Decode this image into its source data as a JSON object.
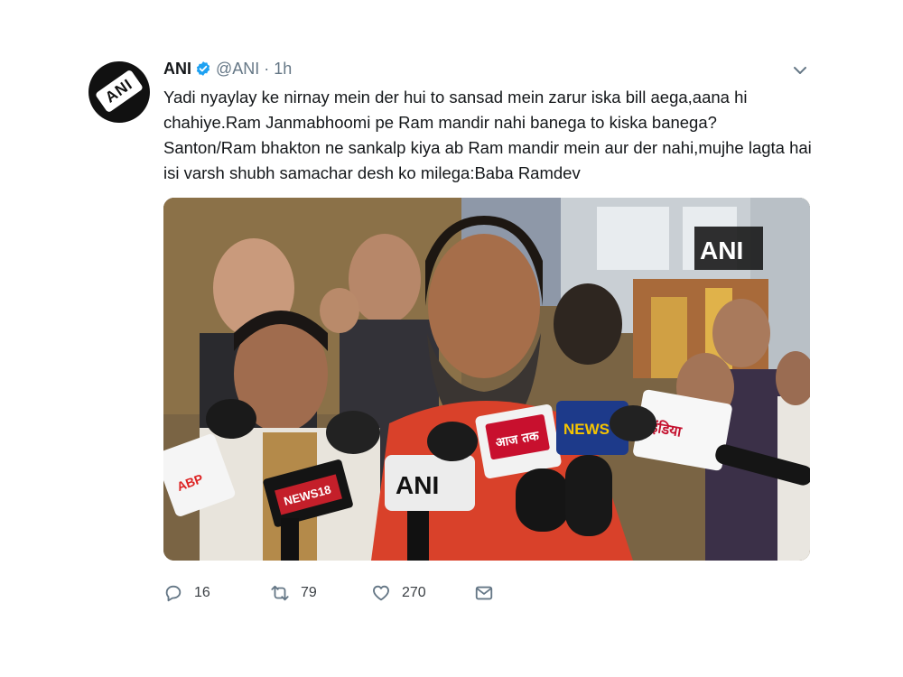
{
  "tweet": {
    "author_name": "ANI",
    "handle": "@ANI",
    "separator": "·",
    "time": "1h",
    "text": "Yadi nyaylay ke nirnay mein der hui to sansad mein zarur iska bill aega,aana hi chahiye.Ram Janmabhoomi pe Ram mandir nahi banega to kiska banega? Santon/Ram bhakton ne sankalp kiya ab Ram mandir mein aur der nahi,mujhe lagta hai isi varsh shubh samachar desh ko milega:Baba Ramdev",
    "avatar_logo": "ANI",
    "media_watermark": "ANI"
  },
  "mic_labels": {
    "abp": "ABP",
    "news18": "NEWS18",
    "ani": "ANI",
    "aajtak": "आज तक",
    "news24": "NEWS 24",
    "india": "इंडिया"
  },
  "actions": {
    "reply_count": "16",
    "retweet_count": "79",
    "like_count": "270"
  },
  "colors": {
    "verified": "#1da1f2",
    "text": "#14171a",
    "secondary": "#657786"
  }
}
